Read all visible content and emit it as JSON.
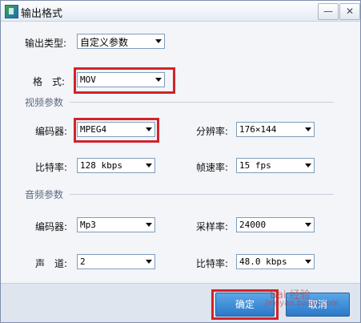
{
  "window": {
    "title": "输出格式",
    "minimize_glyph": "—",
    "close_glyph": "✕"
  },
  "output_type": {
    "label": "输出类型:",
    "value": "自定义参数"
  },
  "format": {
    "label": "格　式:",
    "value": "MOV"
  },
  "video": {
    "section_title": "视频参数",
    "encoder": {
      "label": "编码器:",
      "value": "MPEG4"
    },
    "resolution": {
      "label": "分辨率:",
      "value": "176×144"
    },
    "bitrate": {
      "label": "比特率:",
      "value": "128 kbps"
    },
    "framerate": {
      "label": "帧速率:",
      "value": "15 fps"
    }
  },
  "audio": {
    "section_title": "音频参数",
    "encoder": {
      "label": "编码器:",
      "value": "Mp3"
    },
    "samplerate": {
      "label": "采样率:",
      "value": "24000"
    },
    "channels": {
      "label": "声　道:",
      "value": "2"
    },
    "bitrate": {
      "label": "比特率:",
      "value": "48.0 kbps"
    }
  },
  "buttons": {
    "ok": "确定",
    "cancel": "取消"
  },
  "watermark": {
    "line1": "Bai 经验",
    "line2": "jingyan.baidu.com"
  },
  "colors": {
    "highlight": "#d2232a",
    "button": "#2b78c9"
  }
}
